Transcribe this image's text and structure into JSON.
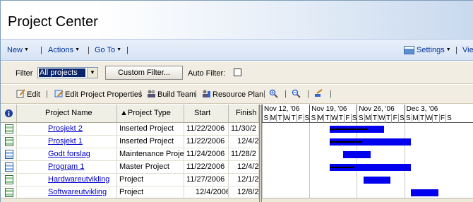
{
  "window": {
    "title": "Project Center"
  },
  "menu": {
    "new": "New",
    "actions": "Actions",
    "goto": "Go To",
    "settings": "Settings",
    "view": "Vie"
  },
  "filter": {
    "label": "Filter",
    "selected": "All projects",
    "custom_button": "Custom Filter...",
    "auto_filter_label": "Auto Filter:",
    "auto_filter_checked": false
  },
  "toolbar": {
    "edit": "Edit",
    "edit_properties": "Edit Project Properties",
    "build_team": "Build Team",
    "resource_plan": "Resource Plan",
    "icons": [
      "edit-icon",
      "edit-properties-icon",
      "build-team-icon",
      "resource-plan-icon",
      "zoom-in-icon",
      "zoom-out-icon",
      "go-to-task-icon"
    ]
  },
  "grid": {
    "columns": [
      {
        "key": "indicator",
        "label": ""
      },
      {
        "key": "name",
        "label": "Project Name"
      },
      {
        "key": "type",
        "label": "▲Project Type"
      },
      {
        "key": "start",
        "label": "Start"
      },
      {
        "key": "finish",
        "label": "Finish"
      }
    ],
    "rows": [
      {
        "name": "Prosjekt 2",
        "type": "Inserted Project",
        "start": "11/22/2006",
        "finish": "11/30/2"
      },
      {
        "name": "Prosjekt 1",
        "type": "Inserted Project",
        "start": "11/22/2006",
        "finish": "12/4/2"
      },
      {
        "name": "Godt forslag",
        "type": "Maintenance Project",
        "start": "11/24/2006",
        "finish": "11/28/2"
      },
      {
        "name": "Program 1",
        "type": "Master Project",
        "start": "11/22/2006",
        "finish": "12/4/2"
      },
      {
        "name": "Hardwareutvikling",
        "type": "Project",
        "start": "11/27/2006",
        "finish": "12/1/2"
      },
      {
        "name": "Softwareutvikling",
        "type": "Project",
        "start": "12/4/2006",
        "finish": "12/8/2"
      }
    ]
  },
  "gantt": {
    "weeks": [
      "Nov 12, '06",
      "Nov 19, '06",
      "Nov 26, '06",
      "Dec 3, '06"
    ],
    "days": [
      "S",
      "M",
      "T",
      "W",
      "T",
      "F",
      "S"
    ],
    "bar_color": "#0000ee",
    "tasks": [
      {
        "start": "2006-11-22",
        "end": "2006-11-30",
        "progress": 0.7
      },
      {
        "start": "2006-11-22",
        "end": "2006-12-04",
        "progress": 0.4
      },
      {
        "start": "2006-11-24",
        "end": "2006-11-28",
        "progress": 0
      },
      {
        "start": "2006-11-22",
        "end": "2006-12-04",
        "progress": 0.3
      },
      {
        "start": "2006-11-27",
        "end": "2006-12-01",
        "progress": 0
      },
      {
        "start": "2006-12-04",
        "end": "2006-12-08",
        "progress": 0
      }
    ]
  }
}
